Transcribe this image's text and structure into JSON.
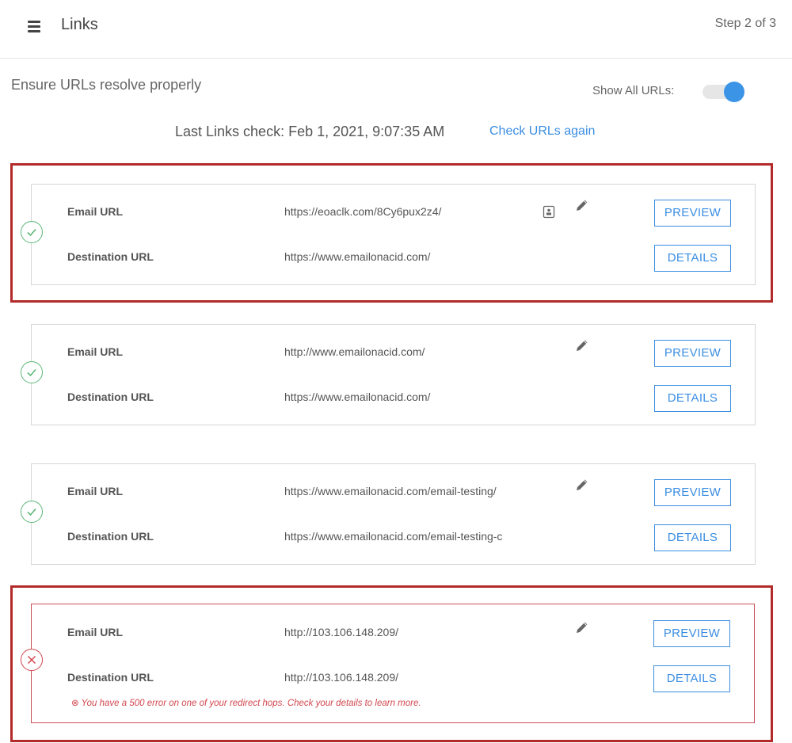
{
  "header": {
    "title": "Links",
    "step": "Step 2 of 3"
  },
  "intro": {
    "subtitle": "Ensure URLs resolve properly",
    "toggle_label": "Show All URLs:",
    "toggle_on": true,
    "last_check": "Last Links check: Feb 1, 2021, 9:07:35 AM",
    "check_again": "Check URLs again"
  },
  "links": [
    {
      "status": "ok",
      "email_label": "Email URL",
      "email_url": "https://eoaclk.com/8Cy6pux2z4/",
      "dest_label": "Destination URL",
      "dest_url": "https://www.emailonacid.com/",
      "preview_label": "PREVIEW",
      "details_label": "DETAILS",
      "has_copy_icon": true
    },
    {
      "status": "ok",
      "email_label": "Email URL",
      "email_url": "http://www.emailonacid.com/",
      "dest_label": "Destination URL",
      "dest_url": "https://www.emailonacid.com/",
      "preview_label": "PREVIEW",
      "details_label": "DETAILS"
    },
    {
      "status": "ok",
      "email_label": "Email URL",
      "email_url": "https://www.emailonacid.com/email-testing/",
      "dest_label": "Destination URL",
      "dest_url": "https://www.emailonacid.com/email-testing-c",
      "preview_label": "PREVIEW",
      "details_label": "DETAILS"
    },
    {
      "status": "error",
      "email_label": "Email URL",
      "email_url": "http://103.106.148.209/",
      "dest_label": "Destination URL",
      "dest_url": "http://103.106.148.209/",
      "preview_label": "PREVIEW",
      "details_label": "DETAILS",
      "error_message": "⊗ You have a 500 error on one of your redirect hops. Check your details to learn more."
    }
  ],
  "colors": {
    "accent": "#3b8ee2",
    "ok": "#5cb876",
    "error": "#d2474f",
    "highlight": "#b22a2a"
  }
}
